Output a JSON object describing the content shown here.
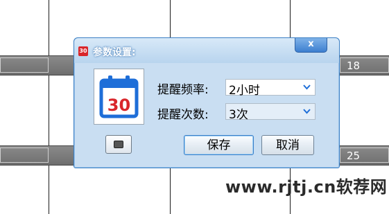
{
  "calendar": {
    "day_numbers": [
      "18",
      "25"
    ]
  },
  "watermark": {
    "text": "www.rjtj.cn软荐网"
  },
  "dialog": {
    "title_icon_text": "30",
    "title": "参数设置:",
    "close_label": "x",
    "calendar_icon_number": "30",
    "frequency_label": "提醒频率:",
    "frequency_value": "2小时",
    "count_label": "提醒次数:",
    "count_value": "3次",
    "save_label": "保存",
    "cancel_label": "取消"
  },
  "colors": {
    "accent": "#1e6ed8",
    "calendar_red": "#d9262b",
    "dialog_bg": "#c9def2"
  }
}
